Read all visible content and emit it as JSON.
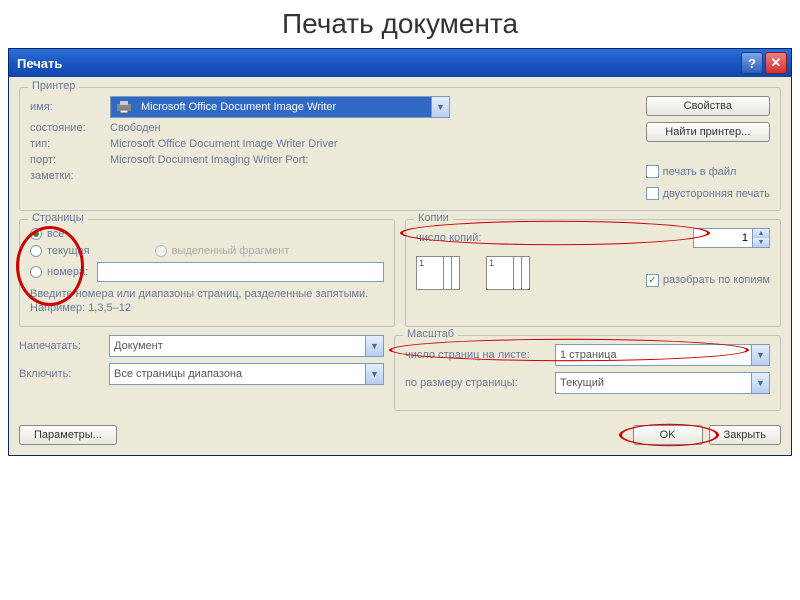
{
  "page_title": "Печать документа",
  "titlebar": {
    "title": "Печать"
  },
  "printer": {
    "group_title": "Принтер",
    "name_label": "имя:",
    "name_value": "Microsoft Office Document Image Writer",
    "status_label": "состояние:",
    "status_value": "Свободен",
    "type_label": "тип:",
    "type_value": "Microsoft Office Document Image Writer Driver",
    "port_label": "порт:",
    "port_value": "Microsoft Document Imaging Writer Port:",
    "notes_label": "заметки:",
    "properties_btn": "Свойства",
    "find_btn": "Найти принтер...",
    "to_file": "печать в файл",
    "duplex": "двусторонняя печать"
  },
  "pages": {
    "group_title": "Страницы",
    "all": "все",
    "current": "текущая",
    "selection": "выделенный фрагмент",
    "numbers": "номера:",
    "hint": "Введите номера или диапазоны страниц, разделенные запятыми. Например: 1,3,5–12"
  },
  "copies": {
    "group_title": "Копии",
    "count_label": "число копий:",
    "count_value": "1",
    "collate": "разобрать по копиям"
  },
  "print_what": {
    "print_label": "Напечатать:",
    "print_value": "Документ",
    "include_label": "Включить:",
    "include_value": "Все страницы диапазона"
  },
  "scale": {
    "group_title": "Масштаб",
    "pages_per_sheet_label": "число страниц на листе:",
    "pages_per_sheet_value": "1 страница",
    "fit_label": "по размеру страницы:",
    "fit_value": "Текущий"
  },
  "footer": {
    "params": "Параметры...",
    "ok": "OK",
    "close": "Закрыть"
  }
}
